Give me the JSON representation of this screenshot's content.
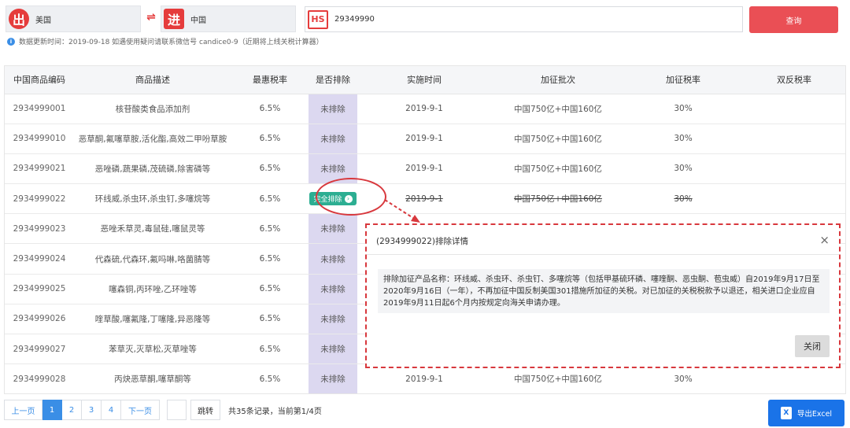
{
  "search": {
    "from_badge": "出",
    "from_country": "美国",
    "swap_symbol": "⇌",
    "to_badge": "进",
    "to_country": "中国",
    "hs_badge": "HS",
    "hs_value": "29349990",
    "query_label": "查询"
  },
  "notice": {
    "icon": "i",
    "text": "数据更新时间：2019-09-18    如遇使用疑问请联系微信号 candice0-9（近期将上线关税计算器）"
  },
  "table": {
    "headers": [
      "中国商品编码",
      "商品描述",
      "最惠税率",
      "是否排除",
      "实施时间",
      "加征批次",
      "加征税率",
      "双反税率"
    ],
    "rows": [
      {
        "code": "2934999001",
        "desc": "核苷酸类食品添加剂",
        "mfn": "6.5%",
        "excluded": "未排除",
        "date": "2019-9-1",
        "batch": "中国750亿+中国160亿",
        "rate": "30%",
        "ad": ""
      },
      {
        "code": "2934999010",
        "desc": "恶草酮,氟噻草胺,活化酯,高效二甲吩草胺",
        "mfn": "6.5%",
        "excluded": "未排除",
        "date": "2019-9-1",
        "batch": "中国750亿+中国160亿",
        "rate": "30%",
        "ad": ""
      },
      {
        "code": "2934999021",
        "desc": "恶唑磷,蔬果磷,茂硫磷,除害磷等",
        "mfn": "6.5%",
        "excluded": "未排除",
        "date": "2019-9-1",
        "batch": "中国750亿+中国160亿",
        "rate": "30%",
        "ad": ""
      },
      {
        "code": "2934999022",
        "desc": "环线威,杀虫环,杀虫钉,多噻烷等",
        "mfn": "6.5%",
        "excluded": "完全排除",
        "date": "2019-9-1",
        "batch": "中国750亿+中国160亿",
        "rate": "30%",
        "ad": ""
      },
      {
        "code": "2934999023",
        "desc": "恶唑禾草灵,毒鼠硅,噻鼠灵等",
        "mfn": "6.5%",
        "excluded": "未排除",
        "date": "",
        "batch": "",
        "rate": "",
        "ad": ""
      },
      {
        "code": "2934999024",
        "desc": "代森硫,代森环,氟吗啉,咯菌腈等",
        "mfn": "6.5%",
        "excluded": "未排除",
        "date": "",
        "batch": "",
        "rate": "",
        "ad": ""
      },
      {
        "code": "2934999025",
        "desc": "噻森铜,丙环唑,乙环唑等",
        "mfn": "6.5%",
        "excluded": "未排除",
        "date": "",
        "batch": "",
        "rate": "",
        "ad": ""
      },
      {
        "code": "2934999026",
        "desc": "喹草酸,噻氟隆,丁噻隆,异恶隆等",
        "mfn": "6.5%",
        "excluded": "未排除",
        "date": "",
        "batch": "",
        "rate": "",
        "ad": ""
      },
      {
        "code": "2934999027",
        "desc": "苯草灭,灭草松,灭草唑等",
        "mfn": "6.5%",
        "excluded": "未排除",
        "date": "",
        "batch": "",
        "rate": "",
        "ad": ""
      },
      {
        "code": "2934999028",
        "desc": "丙炔恶草酮,噻草酮等",
        "mfn": "6.5%",
        "excluded": "未排除",
        "date": "2019-9-1",
        "batch": "中国750亿+中国160亿",
        "rate": "30%",
        "ad": ""
      }
    ]
  },
  "modal": {
    "title": "(2934999022)排除详情",
    "close_symbol": "×",
    "body": "排除加征产品名称：环线威、杀虫环、杀虫钉、多噻烷等（包括甲基硫环磷、噻喹酮、恶虫酮、苞虫威）自2019年9月17日至2020年9月16日（一年），不再加征中国反制美国301措施所加征的关税。对已加征的关税税款予以退还，相关进口企业应自2019年9月11日起6个月内按规定向海关申请办理。",
    "close_label": "关闭"
  },
  "pager": {
    "prev": "上一页",
    "pages": [
      "1",
      "2",
      "3",
      "4"
    ],
    "next": "下一页",
    "jump": "跳转",
    "total": "共35条记录，当前第1/4页"
  },
  "export": {
    "icon": "X",
    "label": "导出Excel"
  },
  "colors": {
    "accent_red": "#e53c3c",
    "query_red": "#ea4f55",
    "excluded_bg": "#dcd8f0",
    "full_excluded_green": "#2cae92",
    "primary_blue": "#3a8ee6",
    "export_blue": "#1a73e8"
  }
}
